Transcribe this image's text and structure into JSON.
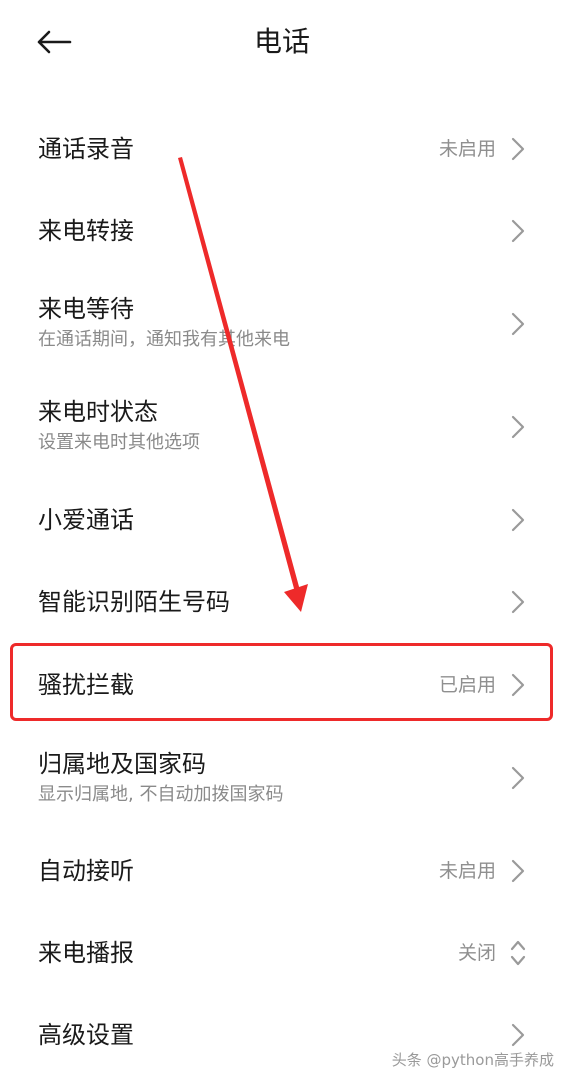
{
  "header": {
    "title": "电话",
    "back_icon": "arrow-left-icon"
  },
  "rows": [
    {
      "title": "通话录音",
      "status": "未启用",
      "control": "chevron-right-icon"
    },
    {
      "title": "来电转接",
      "control": "chevron-right-icon"
    },
    {
      "title": "来电等待",
      "subtitle": "在通话期间，通知我有其他来电",
      "control": "chevron-right-icon"
    },
    {
      "title": "来电时状态",
      "subtitle": "设置来电时其他选项",
      "control": "chevron-right-icon"
    },
    {
      "title": "小爱通话",
      "control": "chevron-right-icon"
    },
    {
      "title": "智能识别陌生号码",
      "control": "chevron-right-icon"
    },
    {
      "title": "骚扰拦截",
      "status": "已启用",
      "control": "chevron-right-icon",
      "highlighted": true
    },
    {
      "title": "归属地及国家码",
      "subtitle": "显示归属地, 不自动加拨国家码",
      "control": "chevron-right-icon"
    },
    {
      "title": "自动接听",
      "status": "未启用",
      "control": "chevron-right-icon"
    },
    {
      "title": "来电播报",
      "status": "关闭",
      "control": "chevron-up-down-icon"
    },
    {
      "title": "高级设置",
      "control": "chevron-right-icon"
    }
  ],
  "annotation": {
    "arrow_color": "#ee2a2a",
    "highlight_color": "#ee2a2a"
  },
  "watermark": "头条 @python高手养成",
  "colors": {
    "text_primary": "#1a1a1a",
    "text_secondary": "#8a8a8a",
    "chevron": "#9a9a9a"
  }
}
